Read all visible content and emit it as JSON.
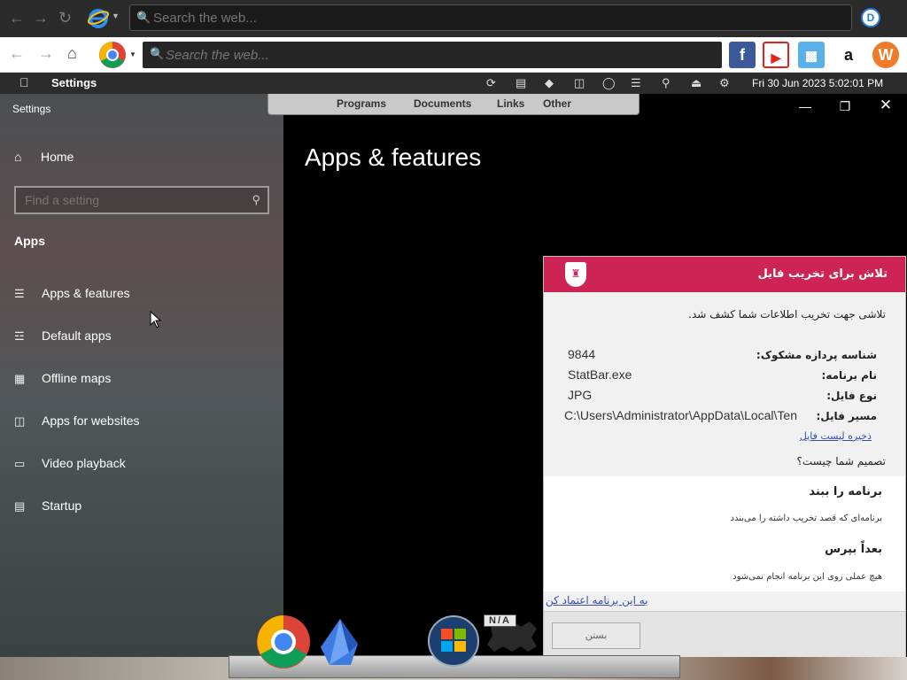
{
  "ie_bar": {
    "search_placeholder": "Search the web...",
    "ie_icon": "ie-icon",
    "profile_initial": "D"
  },
  "toolbar2": {
    "search_placeholder": "Search the web...",
    "home_icon": "home-icon",
    "site_icons": [
      "facebook-icon",
      "youtube-icon",
      "games-icon",
      "amazon-icon",
      "w-icon"
    ]
  },
  "menubar": {
    "app_name": "Settings",
    "clock": "Fri 30 Jun 2023  5:02:01 PM"
  },
  "dock_menu": {
    "items": [
      "Programs",
      "Documents",
      "Links",
      "Other"
    ]
  },
  "settings": {
    "window_title": "Settings",
    "home_label": "Home",
    "find_placeholder": "Find a setting",
    "section_label": "Apps",
    "items": [
      {
        "label": "Apps & features",
        "icon": "list-icon"
      },
      {
        "label": "Default apps",
        "icon": "default-apps-icon"
      },
      {
        "label": "Offline maps",
        "icon": "map-icon"
      },
      {
        "label": "Apps for websites",
        "icon": "link-window-icon"
      },
      {
        "label": "Video playback",
        "icon": "video-icon"
      },
      {
        "label": "Startup",
        "icon": "startup-icon"
      }
    ],
    "page_title": "Apps & features"
  },
  "dialog": {
    "title": "تلاش برای تخریب فایل",
    "message": "تلاشی جهت تخریب اطلاعات شما کشف شد.",
    "rows": [
      {
        "label": "شناسه پردازه مشکوک:",
        "value": "9844"
      },
      {
        "label": "نام برنامه:",
        "value": "StatBar.exe"
      },
      {
        "label": "نوع فایل:",
        "value": "JPG"
      },
      {
        "label": "مسیر فایل:",
        "value": "C:\\Users\\Administrator\\AppData\\Local\\Ten"
      }
    ],
    "save_list_link": "ذخیره لیست فایل",
    "question": "تصمیم شما چیست؟",
    "options": [
      {
        "title": "برنامه را ببند",
        "desc": "برنامه‌ای که قصد تخریب داشته را می‌بندد"
      },
      {
        "title": "بعداً بپرس",
        "desc": "هیچ عملی روی این برنامه انجام نمی‌شود"
      }
    ],
    "trust_link": "به این برنامه اعتماد کن",
    "close_button": "بستن"
  },
  "dock": {
    "badge": "N/A"
  }
}
